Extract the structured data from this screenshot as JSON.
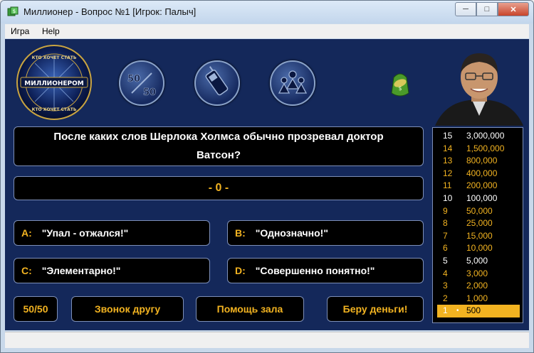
{
  "window": {
    "title": "Миллионер - Вопрос №1 [Игрок: Палыч]",
    "min_icon": "minimize-icon",
    "max_icon": "maximize-icon",
    "close_icon": "close-icon"
  },
  "menu": {
    "items": [
      "Игра",
      "Help"
    ]
  },
  "logo": {
    "text_main": "МИЛЛИОНЕРОМ",
    "text_arc_top": "КТО ХОЧЕТ СТАТЬ",
    "text_arc_bottom": "КТО ХОЧЕТ СТАТЬ"
  },
  "lifelines_top": [
    {
      "name": "fifty-fifty",
      "label": "50/50",
      "icon": "fifty-fifty-icon"
    },
    {
      "name": "phone-a-friend",
      "icon": "phone-icon"
    },
    {
      "name": "ask-the-audience",
      "icon": "audience-icon"
    }
  ],
  "question": {
    "text": "После каких слов Шерлока Холмса обычно прозревал доктор Ватсон?"
  },
  "current_winnings": "- 0 -",
  "answers": [
    {
      "letter": "A:",
      "text": "\"Упал - отжался!\""
    },
    {
      "letter": "B:",
      "text": "\"Однозначно!\""
    },
    {
      "letter": "C:",
      "text": "\"Элементарно!\""
    },
    {
      "letter": "D:",
      "text": "\"Совершенно понятно!\""
    }
  ],
  "buttons": {
    "fifty": "50/50",
    "phone": "Звонок другу",
    "audience": "Помощь зала",
    "take_money": "Беру деньги!"
  },
  "ladder": [
    {
      "num": "15",
      "amount": "3,000,000",
      "type": "milestone"
    },
    {
      "num": "14",
      "amount": "1,500,000",
      "type": "normal"
    },
    {
      "num": "13",
      "amount": "800,000",
      "type": "normal"
    },
    {
      "num": "12",
      "amount": "400,000",
      "type": "normal"
    },
    {
      "num": "11",
      "amount": "200,000",
      "type": "normal"
    },
    {
      "num": "10",
      "amount": "100,000",
      "type": "milestone"
    },
    {
      "num": "9",
      "amount": "50,000",
      "type": "normal"
    },
    {
      "num": "8",
      "amount": "25,000",
      "type": "normal"
    },
    {
      "num": "7",
      "amount": "15,000",
      "type": "normal"
    },
    {
      "num": "6",
      "amount": "10,000",
      "type": "normal"
    },
    {
      "num": "5",
      "amount": "5,000",
      "type": "milestone"
    },
    {
      "num": "4",
      "amount": "3,000",
      "type": "normal"
    },
    {
      "num": "3",
      "amount": "2,000",
      "type": "normal"
    },
    {
      "num": "2",
      "amount": "1,000",
      "type": "normal"
    },
    {
      "num": "1",
      "dot": "•",
      "amount": "500",
      "type": "current"
    }
  ],
  "colors": {
    "background": "#14285a",
    "gold": "#f2b321",
    "box": "#000000",
    "border": "#7d8fb8"
  }
}
